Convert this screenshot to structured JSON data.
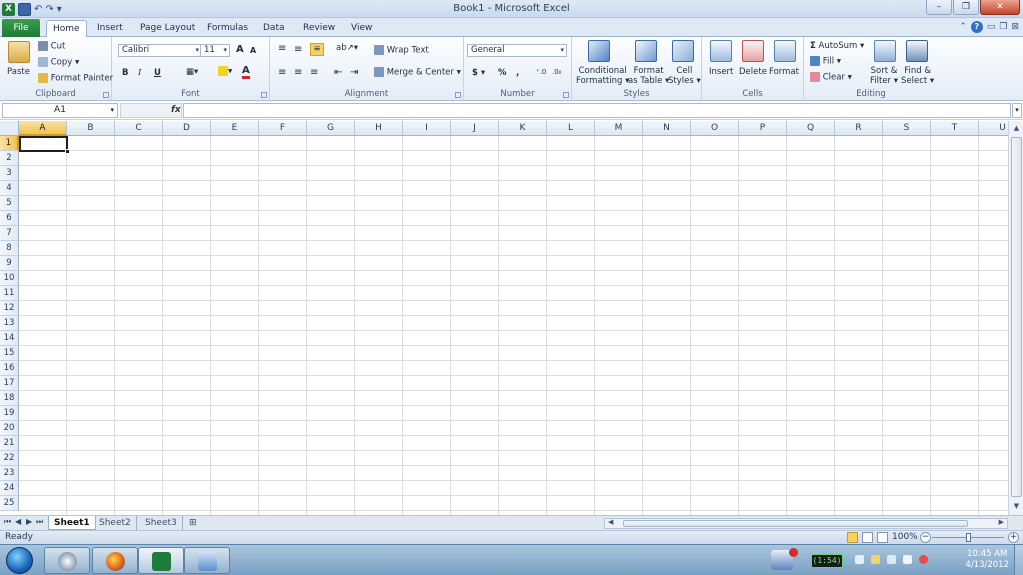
{
  "window": {
    "title": "Book1 - Microsoft Excel"
  },
  "qat": {
    "logo": "X",
    "undo_glyph": "↶",
    "redo_glyph": "↷",
    "more_glyph": "▾"
  },
  "winctrls": {
    "minimize": "–",
    "restore": "❐",
    "close": "✕"
  },
  "tabs": [
    "File",
    "Home",
    "Insert",
    "Page Layout",
    "Formulas",
    "Data",
    "Review",
    "View"
  ],
  "active_tab": "Home",
  "ribbon": {
    "clipboard": {
      "paste": "Paste",
      "cut": "Cut",
      "copy": "Copy ▾",
      "format_painter": "Format Painter",
      "label": "Clipboard"
    },
    "font": {
      "name": "Calibri",
      "size": "11",
      "grow": "A",
      "shrink": "A",
      "bold": "B",
      "italic": "I",
      "underline": "U",
      "label": "Font"
    },
    "alignment": {
      "wrap": "Wrap Text",
      "merge": "Merge & Center",
      "label": "Alignment"
    },
    "number": {
      "format": "General",
      "currency": "$",
      "percent": "%",
      "comma": ",",
      "inc": ".00→.0",
      "dec": ".0→.00",
      "label": "Number"
    },
    "styles": {
      "cond1": "Conditional",
      "cond2": "Formatting ▾",
      "fmt1": "Format",
      "fmt2": "as Table ▾",
      "cell1": "Cell",
      "cell2": "Styles ▾",
      "label": "Styles"
    },
    "cells": {
      "insert": "Insert",
      "delete": "Delete",
      "format": "Format",
      "label": "Cells"
    },
    "editing": {
      "autosum": "AutoSum ▾",
      "fill": "Fill ▾",
      "clear": "Clear ▾",
      "sort1": "Sort &",
      "sort2": "Filter ▾",
      "find1": "Find &",
      "find2": "Select ▾",
      "label": "Editing"
    }
  },
  "formula_bar": {
    "name_box": "A1",
    "fx": "fx",
    "value": ""
  },
  "columns": [
    "A",
    "B",
    "C",
    "D",
    "E",
    "F",
    "G",
    "H",
    "I",
    "J",
    "K",
    "L",
    "M",
    "N",
    "O",
    "P",
    "Q",
    "R",
    "S",
    "T",
    "U"
  ],
  "rows": [
    "1",
    "2",
    "3",
    "4",
    "5",
    "6",
    "7",
    "8",
    "9",
    "10",
    "11",
    "12",
    "13",
    "14",
    "15",
    "16",
    "17",
    "18",
    "19",
    "20",
    "21",
    "22",
    "23",
    "24",
    "25"
  ],
  "active_cell": {
    "col": "A",
    "row": "1"
  },
  "sheets": [
    "Sheet1",
    "Sheet2",
    "Sheet3"
  ],
  "active_sheet": "Sheet1",
  "status": {
    "ready": "Ready",
    "zoom": "100%"
  },
  "taskbar": {
    "battery": "(1:54)",
    "time": "10:45 AM",
    "date": "4/13/2012"
  },
  "colors": {
    "excel_green": "#1f7a3b",
    "selection": "#f1c24f",
    "ribbon_bg": "#e3ecf7"
  }
}
